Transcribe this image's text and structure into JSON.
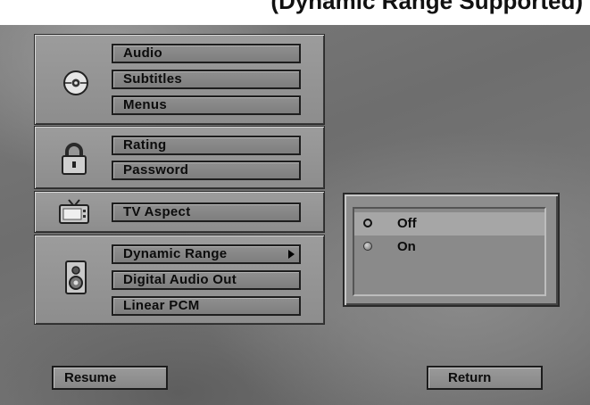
{
  "header": {
    "title": "(Dynamic Range Supported)"
  },
  "menu": {
    "groups": [
      {
        "icon": "disc-icon",
        "items": [
          "Audio",
          "Subtitles",
          "Menus"
        ]
      },
      {
        "icon": "padlock-icon",
        "items": [
          "Rating",
          "Password"
        ]
      },
      {
        "icon": "tv-icon",
        "items": [
          "TV Aspect"
        ]
      },
      {
        "icon": "speaker-icon",
        "items": [
          "Dynamic Range",
          "Digital Audio Out",
          "Linear PCM"
        ]
      }
    ],
    "active_item": "Dynamic Range"
  },
  "options": {
    "items": [
      {
        "label": "Off",
        "state": "unselected"
      },
      {
        "label": "On",
        "state": "selected"
      }
    ]
  },
  "buttons": {
    "resume": "Resume",
    "return": "Return"
  }
}
